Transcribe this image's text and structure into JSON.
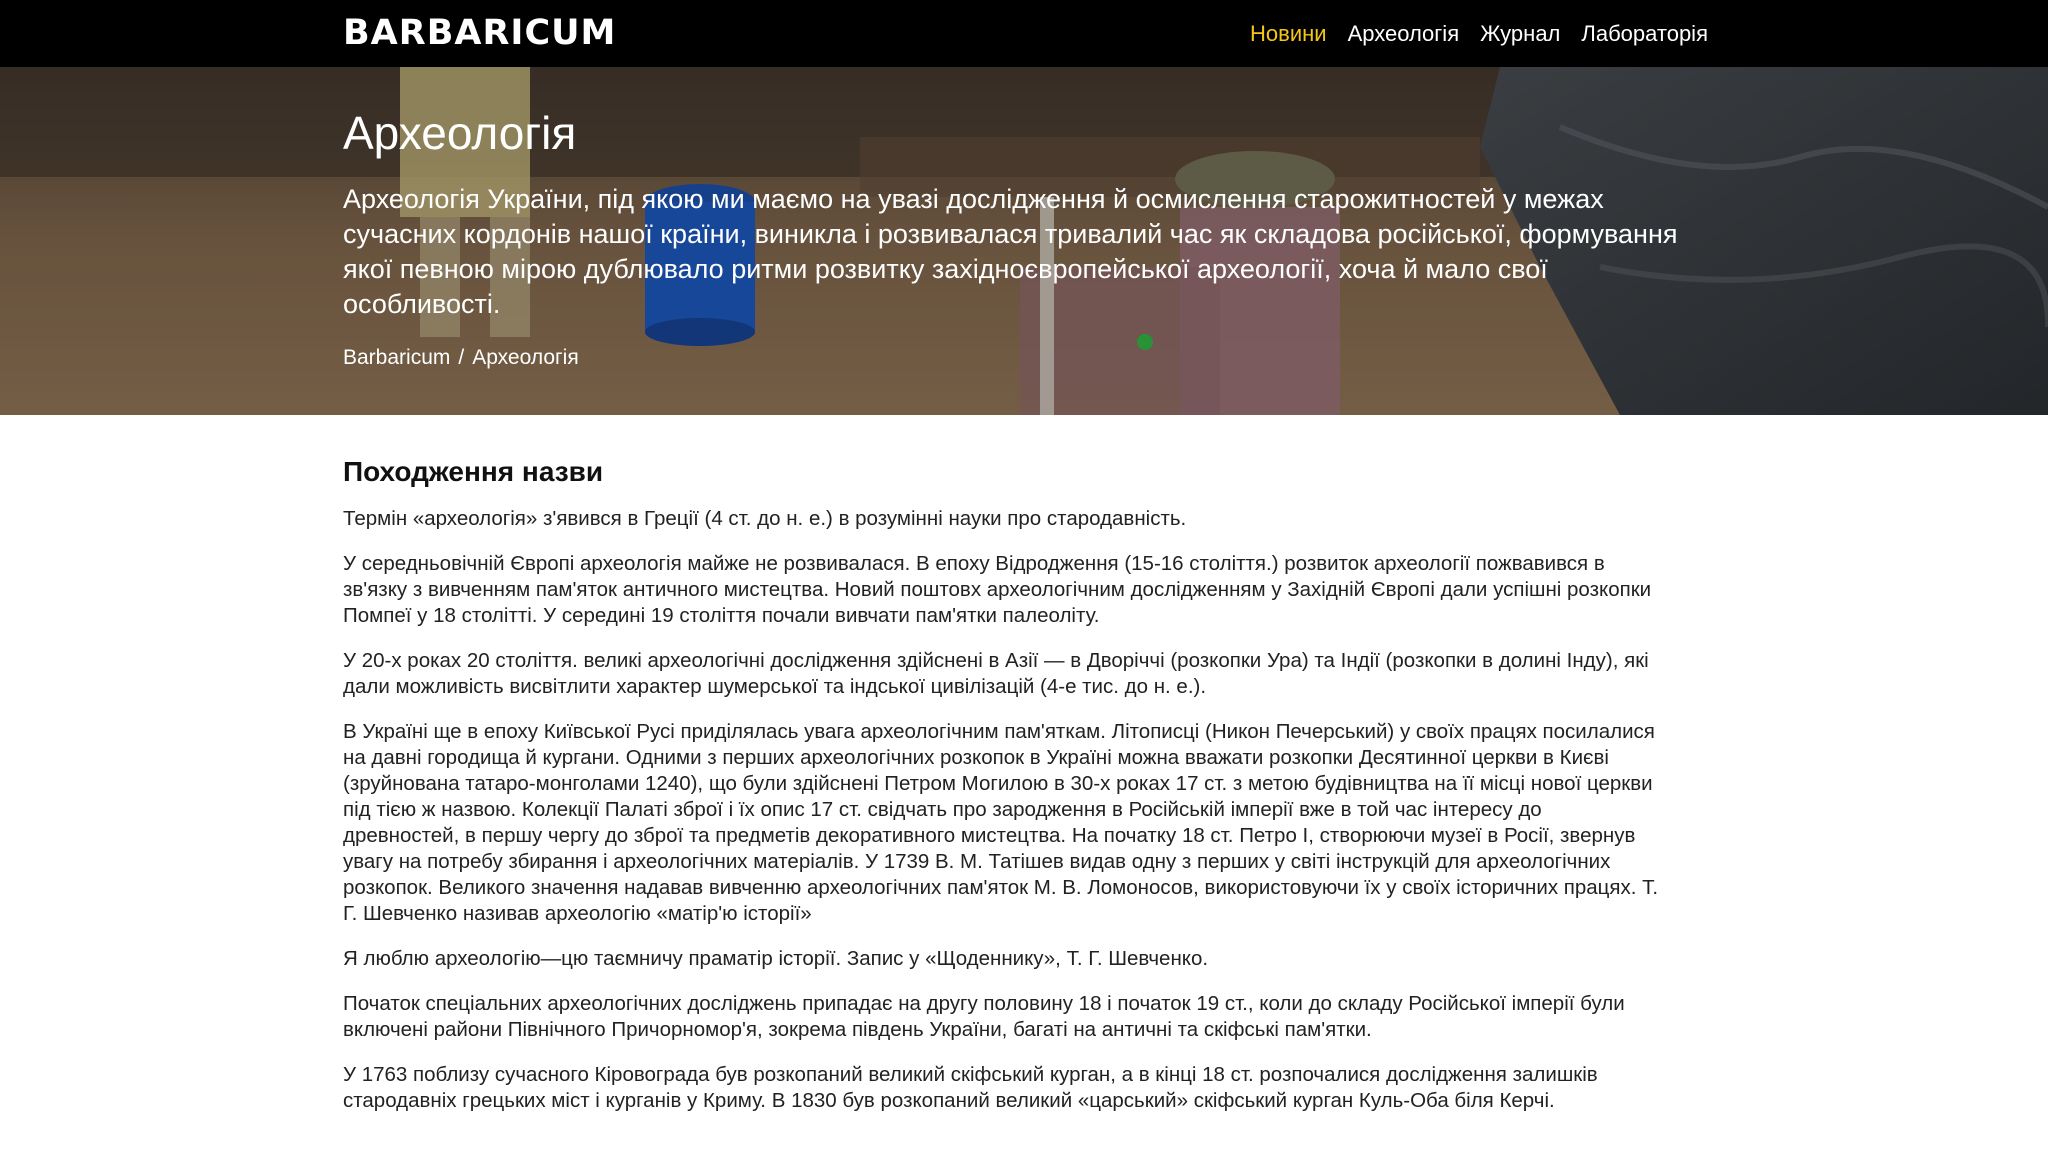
{
  "brand": {
    "logo_text": "BARBARICUM"
  },
  "nav": {
    "items": [
      {
        "label": "Новини"
      },
      {
        "label": "Археологія"
      },
      {
        "label": "Журнал"
      },
      {
        "label": "Лабораторія"
      }
    ],
    "active_color": "#f5c518"
  },
  "hero": {
    "title": "Археологія",
    "lead": "Археологія України, під якою ми маємо на увазі дослідження й осмислення старожитностей у межах сучасних кордонів нашої країни, виникла і розвивалася тривалий час як складова російської, формування якої певною мірою дублювало ритми розвитку західноєвропейської археології, хоча й мало свої особливості.",
    "breadcrumb": {
      "home": "Barbaricum",
      "separator": "/",
      "current": "Археологія"
    }
  },
  "article": {
    "heading": "Походження назви",
    "paragraphs": [
      "Термін «археологія» з'явився в Греції (4 ст. до н. е.) в розумінні науки про стародавність.",
      "У середньовічній Європі археологія майже не розвивалася. В епоху Відродження (15-16 століття.) розвиток археології пожвавився в зв'язку з вивченням пам'яток античного мистецтва. Новий поштовх археологічним дослідженням у Західній Європі дали успішні розкопки Помпеї у 18 столітті. У середині 19 століття почали вивчати пам'ятки палеоліту.",
      "У 20-х роках 20 століття. великі археологічні дослідження здійснені в Азії — в Дворіччі (розкопки Ура) та Індії (розкопки в долині Інду), які дали можливість висвітлити характер шумерської та індської цивілізацій (4-е тис. до н. е.).",
      "В Україні ще в епоху Київської Русі приділялась увага археологічним пам'яткам. Літописці (Никон Печерський) у своїх працях посилалися на давні городища й кургани. Одними з перших археологічних розкопок в Україні можна вважати розкопки Десятинної церкви в Києві (зруйнована татаро-монголами 1240), що були здійснені Петром Могилою в 30-х роках 17 ст. з метою будівництва на її місці нової церкви під тією ж назвою. Колекції Палаті зброї і їх опис 17 ст. свідчать про зародження в Російській імперії вже в той час інтересу до древностей, в першу чергу до зброї та предметів декоративного мистецтва. На початку 18 ст. Петро I, створюючи музеї в Росії, звернув увагу на потребу збирання і археологічних матеріалів. У 1739 В. М.  Татішев видав одну з перших у світі інструкцій для археологічних розкопок. Великого значення надавав вивченню археологічних пам'яток М. В. Ломоносов, використовуючи їх у своїх історичних працях. Т. Г. Шевченко називав археологію «матір'ю історії»",
      "Я люблю археологію—цю таємничу праматір історії. Запис у «Щоденнику», Т. Г. Шевченко.",
      "Початок спеціальних археологічних досліджень припадає на другу половину 18 і початок 19 ст., коли до складу Російської імперії були включені райони Північного Причорномор'я, зокрема південь України, багаті на античні та скіфські пам'ятки.",
      "У 1763 поблизу сучасного Кіровограда був розкопаний великий скіфський курган, а в кінці 18 ст. розпочалися дослідження залишків стародавніх грецьких міст і курганів у Криму. В 1830 був розкопаний великий «царський» скіфський курган Куль-Оба біля Керчі."
    ]
  }
}
